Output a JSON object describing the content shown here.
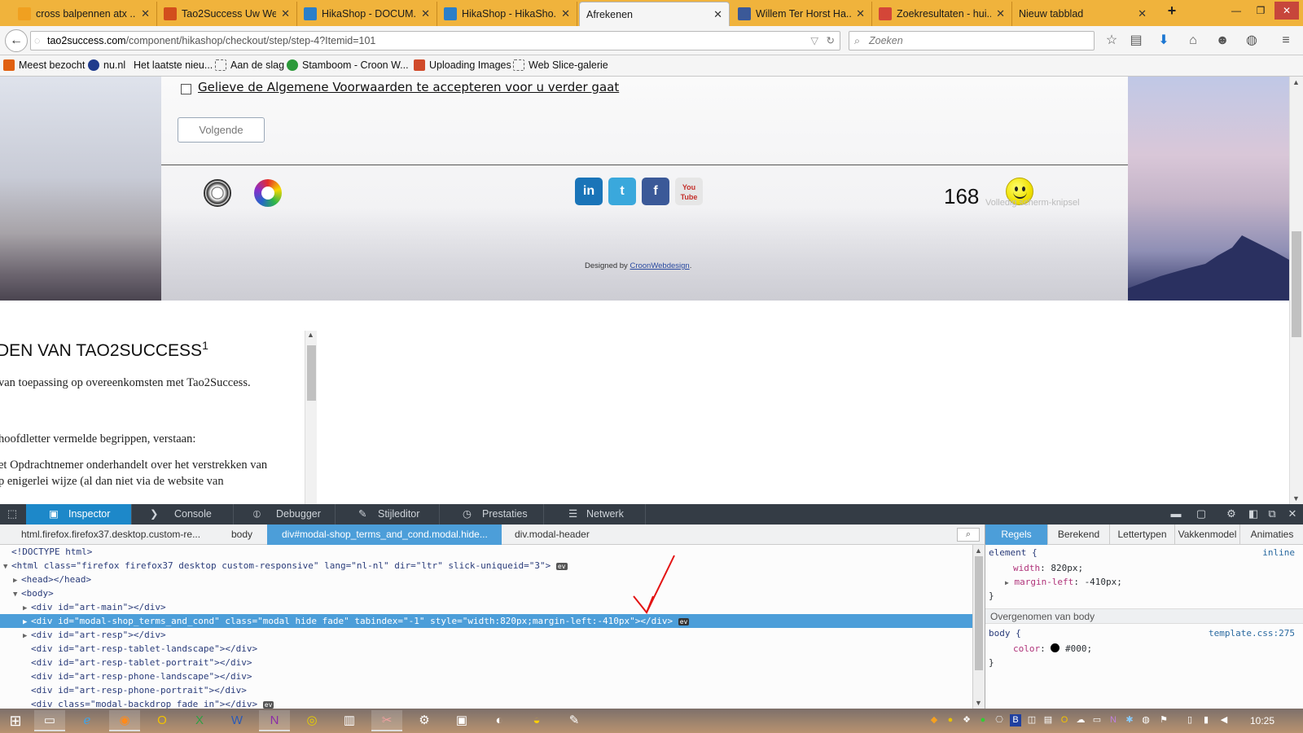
{
  "browser": {
    "tabs": [
      {
        "label": "cross balpennen atx ...",
        "favicon_color": "#f0a020",
        "active": false
      },
      {
        "label": "Tao2Success Uw We...",
        "favicon_color": "#d24e1c",
        "active": false
      },
      {
        "label": "HikaShop - DOCUM...",
        "favicon_color": "#2b7fc9",
        "active": false
      },
      {
        "label": "HikaShop - HikaSho...",
        "favicon_color": "#2b7fc9",
        "active": false
      },
      {
        "label": "Afrekenen",
        "favicon_color": "",
        "active": true
      },
      {
        "label": "Willem Ter Horst Ha...",
        "favicon_color": "#3b5998",
        "active": false
      },
      {
        "label": "Zoekresultaten - hui...",
        "favicon_color": "#d44638",
        "active": false
      },
      {
        "label": "Nieuw tabblad",
        "favicon_color": "",
        "active": false
      }
    ],
    "new_tab_symbol": "+",
    "close_symbol": "✕",
    "window_controls": {
      "minimize": "—",
      "restore": "❐",
      "close": "✕"
    },
    "url": {
      "host": "tao2success.com",
      "path": "/component/hikashop/checkout/step/step-4?Itemid=101"
    },
    "search_placeholder": "Zoeken",
    "bookmarks": [
      {
        "label": "Meest bezocht",
        "color": "#e06010"
      },
      {
        "label": "nu.nl",
        "color": "#1f3b8c"
      },
      {
        "label": "Het laatste nieu...",
        "color": ""
      },
      {
        "label": "Aan de slag",
        "color": ""
      },
      {
        "label": "Stamboom - Croon W...",
        "color": "#2c9a3a"
      },
      {
        "label": "Uploading Images",
        "color": "#d04a2a"
      },
      {
        "label": "Web Slice-galerie",
        "color": ""
      }
    ]
  },
  "page": {
    "terms_text": "Gelieve de Algemene Voorwaarden te accepteren voor u verder gaat",
    "next_button": "Volgende",
    "social": [
      {
        "name": "in",
        "color": "#1a74b8"
      },
      {
        "name": "t",
        "color": "#3aa8dc"
      },
      {
        "name": "f",
        "color": "#3b5998"
      },
      {
        "name": "You Tube",
        "color": "#d9d9d9"
      }
    ],
    "counter": "168",
    "snip_label": "Volledig scherm-knipsel",
    "designed_by_prefix": "Designed by ",
    "designed_by_link": "CroonWebdesign",
    "designed_by_suffix": "."
  },
  "modal": {
    "heading": "DEN VAN TAO2SUCCESS",
    "heading_sup": "1",
    "lines": [
      "van toepassing op overeenkomsten met Tao2Success.",
      "hoofdletter vermelde begrippen, verstaan:",
      "et Opdrachtnemer onderhandelt over het verstrekken van",
      "p enigerlei wijze (al dan niet via de website van"
    ]
  },
  "devtools": {
    "tabs": [
      "Inspector",
      "Console",
      "Debugger",
      "Stijleditor",
      "Prestaties",
      "Netwerk"
    ],
    "breadcrumbs": [
      "html.firefox.firefox37.desktop.custom-re...",
      "body",
      "div#modal-shop_terms_and_cond.modal.hide...",
      "div.modal-header"
    ],
    "markup": [
      "<!DOCTYPE html>",
      "<html class=\"firefox firefox37 desktop custom-responsive\" lang=\"nl-nl\" dir=\"ltr\" slick-uniqueid=\"3\">",
      "<head></head>",
      "<body>",
      "<div id=\"art-main\"></div>",
      "<div id=\"modal-shop_terms_and_cond\" class=\"modal hide fade\" tabindex=\"-1\" style=\"width:820px;margin-left:-410px\"></div>",
      "<div id=\"art-resp\"></div>",
      "<div id=\"art-resp-tablet-landscape\"></div>",
      "<div id=\"art-resp-tablet-portrait\"></div>",
      "<div id=\"art-resp-phone-landscape\"></div>",
      "<div id=\"art-resp-phone-portrait\"></div>",
      "<div class=\"modal-backdrop fade in\"></div>"
    ],
    "event_badge": "ev",
    "rules_tabs": [
      "Regels",
      "Berekend",
      "Lettertypen",
      "Vakkenmodel",
      "Animaties"
    ],
    "rules": {
      "element_selector": "element {",
      "inline_label": "inline",
      "width_prop": "width",
      "width_val": "820px;",
      "margin_prop": "margin-left",
      "margin_val": "-410px;",
      "close_brace": "}",
      "inherited_header": "Overgenomen van body",
      "body_selector": "body {",
      "body_source": "template.css:275",
      "color_prop": "color",
      "color_val": "#000;",
      "swatch_color": "#000000"
    }
  },
  "taskbar": {
    "clock": "10:25"
  }
}
